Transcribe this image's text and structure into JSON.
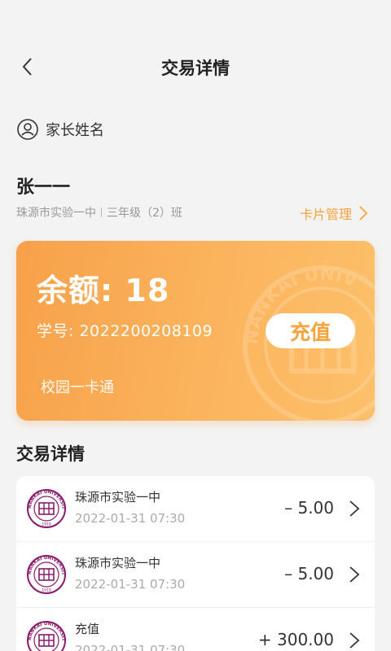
{
  "header": {
    "title": "交易详情",
    "back_icon": "chevron-left-icon"
  },
  "parent": {
    "label": "家长姓名",
    "icon": "user-circle-icon"
  },
  "student": {
    "name": "张一一",
    "school": "珠源市实验一中",
    "class": "三年级（2）班",
    "card_manage_label": "卡片管理"
  },
  "card": {
    "balance_text": "余额: 18",
    "student_no_text": "学号: 2022200208109",
    "recharge_label": "充值",
    "card_type": "校园一卡通",
    "watermark_text": "NANKAI UNIV",
    "colors": {
      "gradient_start": "#f7a14a",
      "gradient_end": "#fdc06a",
      "accent": "#f7a33c"
    }
  },
  "transactions": {
    "title": "交易详情",
    "items": [
      {
        "merchant": "珠源市实验一中",
        "time": "2022-01-31   07:30",
        "amount": "– 5.00"
      },
      {
        "merchant": "珠源市实验一中",
        "time": "2022-01-31   07:30",
        "amount": "– 5.00"
      },
      {
        "merchant": "充值",
        "time": "2022-01-31   07:30",
        "amount": "+ 300.00"
      }
    ],
    "logo_color": "#8a1a6b",
    "logo_text": "NANKAI UNIVERSITY",
    "logo_year": "1919"
  }
}
